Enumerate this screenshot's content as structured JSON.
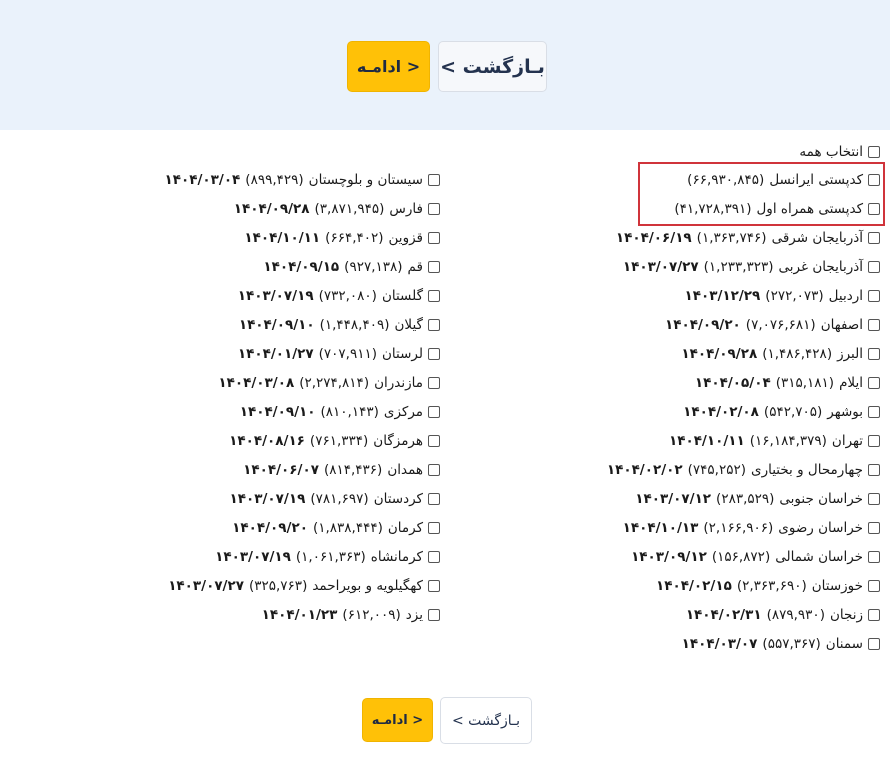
{
  "buttons": {
    "continue_label": "ادامـه >",
    "back_label": "< بـازگشت"
  },
  "select_all": "انتخاب همه",
  "operators": [
    {
      "name": "کدپستی ایرانسل",
      "count": "(۶۶,۹۳۰,۸۴۵)"
    },
    {
      "name": "کدپستی همراه اول",
      "count": "(۴۱,۷۲۸,۳۹۱)"
    }
  ],
  "provinces_right": [
    {
      "name": "آذربایجان شرقی",
      "count": "(۱,۳۶۳,۷۴۶)",
      "date": "۱۴۰۴/۰۶/۱۹"
    },
    {
      "name": "آذربایجان غربی",
      "count": "(۱,۲۳۳,۳۲۳)",
      "date": "۱۴۰۳/۰۷/۲۷"
    },
    {
      "name": "اردبیل",
      "count": "(۲۷۲,۰۷۳)",
      "date": "۱۴۰۳/۱۲/۲۹"
    },
    {
      "name": "اصفهان",
      "count": "(۷,۰۷۶,۶۸۱)",
      "date": "۱۴۰۴/۰۹/۲۰"
    },
    {
      "name": "البرز",
      "count": "(۱,۴۸۶,۴۲۸)",
      "date": "۱۴۰۴/۰۹/۲۸"
    },
    {
      "name": "ایلام",
      "count": "(۳۱۵,۱۸۱)",
      "date": "۱۴۰۴/۰۵/۰۴"
    },
    {
      "name": "بوشهر",
      "count": "(۵۴۲,۷۰۵)",
      "date": "۱۴۰۴/۰۲/۰۸"
    },
    {
      "name": "تهران",
      "count": "(۱۶,۱۸۴,۳۷۹)",
      "date": "۱۴۰۴/۱۰/۱۱"
    },
    {
      "name": "چهارمحال و بختیاری",
      "count": "(۷۴۵,۲۵۲)",
      "date": "۱۴۰۴/۰۲/۰۲"
    },
    {
      "name": "خراسان جنوبی",
      "count": "(۲۸۳,۵۲۹)",
      "date": "۱۴۰۳/۰۷/۱۲"
    },
    {
      "name": "خراسان رضوی",
      "count": "(۲,۱۶۶,۹۰۶)",
      "date": "۱۴۰۴/۱۰/۱۳"
    },
    {
      "name": "خراسان شمالی",
      "count": "(۱۵۶,۸۷۲)",
      "date": "۱۴۰۳/۰۹/۱۲"
    },
    {
      "name": "خوزستان",
      "count": "(۲,۳۶۳,۶۹۰)",
      "date": "۱۴۰۴/۰۲/۱۵"
    },
    {
      "name": "زنجان",
      "count": "(۸۷۹,۹۳۰)",
      "date": "۱۴۰۴/۰۲/۳۱"
    },
    {
      "name": "سمنان",
      "count": "(۵۵۷,۳۶۷)",
      "date": "۱۴۰۴/۰۳/۰۷"
    }
  ],
  "provinces_left": [
    {
      "name": "سیستان و بلوچستان",
      "count": "(۸۹۹,۴۲۹)",
      "date": "۱۴۰۴/۰۳/۰۴"
    },
    {
      "name": "فارس",
      "count": "(۳,۸۷۱,۹۴۵)",
      "date": "۱۴۰۴/۰۹/۲۸"
    },
    {
      "name": "قزوین",
      "count": "(۶۶۴,۴۰۲)",
      "date": "۱۴۰۴/۱۰/۱۱"
    },
    {
      "name": "قم",
      "count": "(۹۲۷,۱۳۸)",
      "date": "۱۴۰۴/۰۹/۱۵"
    },
    {
      "name": "گلستان",
      "count": "(۷۳۲,۰۸۰)",
      "date": "۱۴۰۳/۰۷/۱۹"
    },
    {
      "name": "گیلان",
      "count": "(۱,۴۴۸,۴۰۹)",
      "date": "۱۴۰۴/۰۹/۱۰"
    },
    {
      "name": "لرستان",
      "count": "(۷۰۷,۹۱۱)",
      "date": "۱۴۰۴/۰۱/۲۷"
    },
    {
      "name": "مازندران",
      "count": "(۲,۲۷۴,۸۱۴)",
      "date": "۱۴۰۴/۰۳/۰۸"
    },
    {
      "name": "مرکزی",
      "count": "(۸۱۰,۱۴۳)",
      "date": "۱۴۰۴/۰۹/۱۰"
    },
    {
      "name": "هرمزگان",
      "count": "(۷۶۱,۳۳۴)",
      "date": "۱۴۰۴/۰۸/۱۶"
    },
    {
      "name": "همدان",
      "count": "(۸۱۴,۴۳۶)",
      "date": "۱۴۰۴/۰۶/۰۷"
    },
    {
      "name": "کردستان",
      "count": "(۷۸۱,۶۹۷)",
      "date": "۱۴۰۳/۰۷/۱۹"
    },
    {
      "name": "کرمان",
      "count": "(۱,۸۳۸,۴۴۴)",
      "date": "۱۴۰۴/۰۹/۲۰"
    },
    {
      "name": "کرمانشاه",
      "count": "(۱,۰۶۱,۳۶۳)",
      "date": "۱۴۰۳/۰۷/۱۹"
    },
    {
      "name": "کهگیلویه و بویراحمد",
      "count": "(۳۲۵,۷۶۳)",
      "date": "۱۴۰۳/۰۷/۲۷"
    },
    {
      "name": "یزد",
      "count": "(۶۱۲,۰۰۹)",
      "date": "۱۴۰۴/۰۱/۲۳"
    }
  ]
}
